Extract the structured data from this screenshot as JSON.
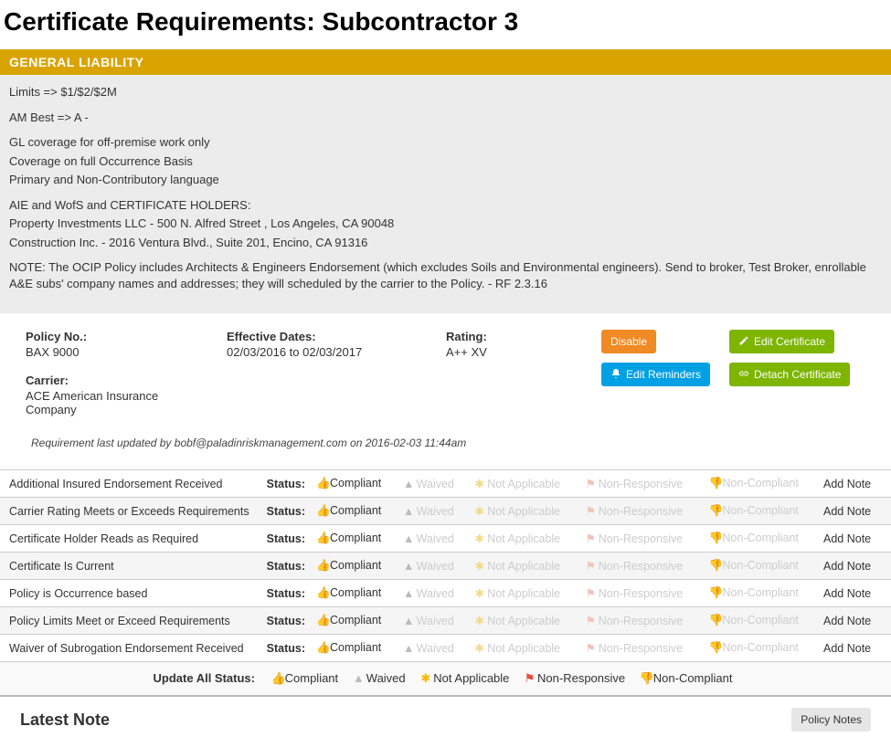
{
  "page_title": "Certificate Requirements: Subcontractor 3",
  "section_header": "GENERAL LIABILITY",
  "requirements_text": {
    "limits": "Limits => $1/$2/$2M",
    "am_best": "AM Best => A -",
    "coverage_lines": [
      "GL coverage for off-premise work only",
      "Coverage on full Occurrence Basis",
      "Primary and Non-Contributory language"
    ],
    "holders_lines": [
      "AIE and WofS and CERTIFICATE HOLDERS:",
      "Property Investments LLC - 500 N. Alfred Street , Los Angeles, CA 90048",
      "Construction Inc. - 2016 Ventura Blvd., Suite 201, Encino, CA 91316"
    ],
    "note": "NOTE: The OCIP Policy includes Architects & Engineers Endorsement (which excludes Soils and Environmental engineers). Send to broker, Test Broker, enrollable A&E subs' company names and addresses; they will scheduled by the carrier to the Policy. - RF 2.3.16"
  },
  "policy": {
    "policy_no_label": "Policy No.:",
    "policy_no_value": "BAX 9000",
    "carrier_label": "Carrier:",
    "carrier_value": "ACE American Insurance Company",
    "eff_label": "Effective Dates:",
    "eff_value": "02/03/2016 to 02/03/2017",
    "rating_label": "Rating:",
    "rating_value": "A++ XV"
  },
  "buttons": {
    "disable": "Disable",
    "edit_cert": "Edit Certificate",
    "edit_rem": "Edit Reminders",
    "detach": "Detach Certificate",
    "policy_notes": "Policy Notes"
  },
  "updated": {
    "prefix": "Requirement",
    "mid": " last updated by ",
    "user": "bobf@paladinriskmanagement.com",
    "on": " on ",
    "ts": "2016-02-03 11:44am"
  },
  "status_label": "Status:",
  "status_opts": {
    "compliant": "Compliant",
    "waived": "Waived",
    "na": "Not Applicable",
    "nonresp": "Non-Responsive",
    "noncomp": "Non-Compliant"
  },
  "add_note": "Add Note",
  "req_items": [
    {
      "name": "Additional Insured Endorsement Received"
    },
    {
      "name": "Carrier Rating Meets or Exceeds Requirements"
    },
    {
      "name": "Certificate Holder Reads as Required"
    },
    {
      "name": "Certificate Is Current"
    },
    {
      "name": "Policy is Occurrence based"
    },
    {
      "name": "Policy Limits Meet or Exceed Requirements"
    },
    {
      "name": "Waiver of Subrogation Endorsement Received"
    }
  ],
  "update_all_label": "Update All Status:",
  "latest_note_heading": "Latest Note"
}
